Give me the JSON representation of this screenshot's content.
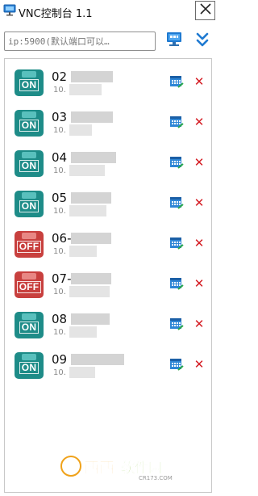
{
  "window": {
    "title": "VNC控制台 1.1",
    "close_symbol": "✕"
  },
  "toolbar": {
    "search_placeholder": "ip:5900(默认端口可以…",
    "monitor_icon": "monitor-icon",
    "expand_icon": "double-chevron-down-icon"
  },
  "colors": {
    "on": "#1e8c88",
    "off": "#c8403e",
    "delete": "#d41b22",
    "accent": "#1f7ad1"
  },
  "servers": [
    {
      "name": "02",
      "ip": "10.",
      "status": "ON"
    },
    {
      "name": "03",
      "ip": "10.",
      "status": "ON"
    },
    {
      "name": "04",
      "ip": "10.",
      "status": "ON"
    },
    {
      "name": "05",
      "ip": "10.",
      "status": "ON"
    },
    {
      "name": "06-",
      "ip": "10.",
      "status": "OFF"
    },
    {
      "name": "07-",
      "ip": "10.",
      "status": "OFF"
    },
    {
      "name": "08",
      "ip": "10.",
      "status": "ON"
    },
    {
      "name": "09",
      "ip": "10.",
      "status": "ON"
    }
  ],
  "watermark": {
    "logo_text": "西西软件园",
    "url": "CR173.COM"
  }
}
